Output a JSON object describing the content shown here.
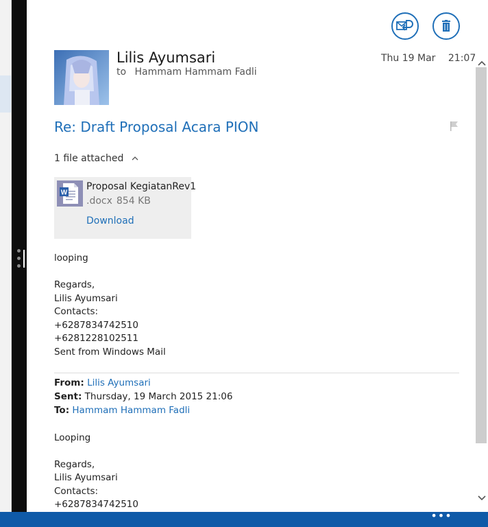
{
  "header": {
    "sender_name": "Lilis Ayumsari",
    "to_label": "to",
    "to_name": "Hammam Hammam Fadli",
    "date": "Thu 19 Mar",
    "time": "21:07"
  },
  "subject": "Re: Draft Proposal Acara PION",
  "attachments": {
    "count_label": "1 file attached",
    "file_name": "Proposal KegiatanRev1",
    "file_ext": ".docx",
    "file_size": "854 KB",
    "download_label": "Download",
    "icon": "word-document-icon"
  },
  "body_lines": [
    "looping",
    "Regards,",
    "Lilis Ayumsari",
    "Contacts:",
    "+6287834742510",
    "+6281228102511",
    "Sent from Windows Mail"
  ],
  "quoted": {
    "from_label": "From:",
    "from_value": "Lilis Ayumsari",
    "sent_label": "Sent:",
    "sent_value": "Thursday, 19 March 2015 21:06",
    "to_label": "To:",
    "to_value": "Hammam Hammam Fadli",
    "body_lines": [
      "Looping",
      "Regards,",
      "Lilis Ayumsari",
      "Contacts:",
      "+6287834742510"
    ]
  },
  "toolbar": {
    "reply_icon": "reply-icon",
    "delete_icon": "trash-icon",
    "more_label": "•••"
  },
  "colors": {
    "accent": "#1f6fb8",
    "bottom_bar": "#0f5aa8",
    "divider": "#0d0d0d"
  }
}
